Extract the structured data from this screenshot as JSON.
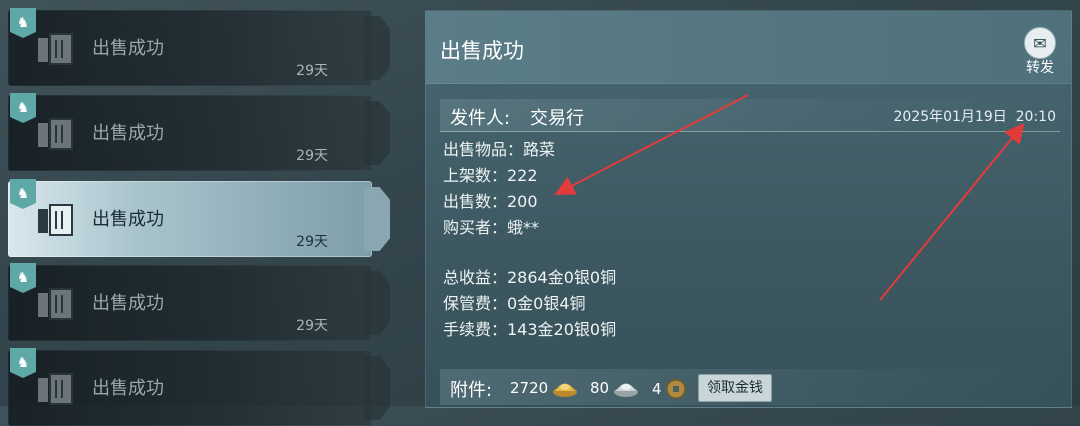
{
  "mail_list": [
    {
      "title": "出售成功",
      "days": "29天",
      "selected": false
    },
    {
      "title": "出售成功",
      "days": "29天",
      "selected": false
    },
    {
      "title": "出售成功",
      "days": "29天",
      "selected": true
    },
    {
      "title": "出售成功",
      "days": "29天",
      "selected": false
    },
    {
      "title": "出售成功",
      "days": "",
      "selected": false
    }
  ],
  "detail": {
    "title": "出售成功",
    "forward_label": "转发",
    "sender_label": "发件人:",
    "sender_name": "交易行",
    "date": "2025年01月19日",
    "time": "20:10",
    "lines_top": [
      "出售物品：路菜",
      "上架数：222",
      "出售数：200",
      "购买者：蛾**"
    ],
    "lines_bottom": [
      "总收益：2864金0银0铜",
      "保管费：0金0银4铜",
      "手续费：143金20银0铜"
    ],
    "attachment_label": "附件:",
    "attachments": [
      {
        "amount": "2720",
        "icon": "gold-ingot-icon"
      },
      {
        "amount": "80",
        "icon": "silver-ingot-icon"
      },
      {
        "amount": "4",
        "icon": "copper-coin-icon"
      }
    ],
    "claim_button": "领取金钱"
  },
  "colors": {
    "badge": "#5fa8a8",
    "annotation_arrow": "#e23b3b",
    "gold": "#e8b84a",
    "silver": "#cfd6d8",
    "copper": "#b08a3e"
  }
}
